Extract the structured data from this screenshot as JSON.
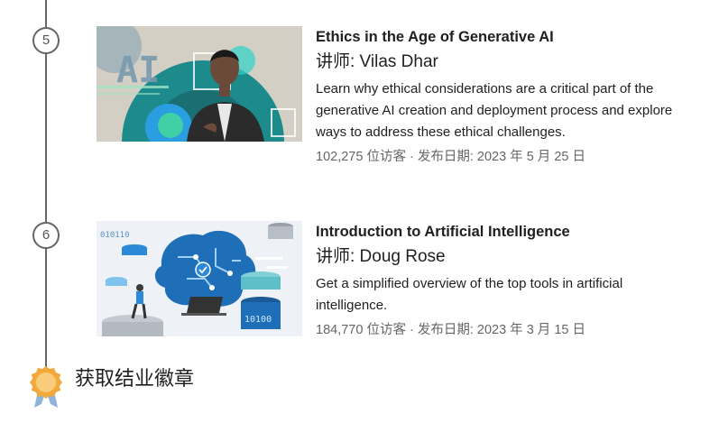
{
  "courses": [
    {
      "step": "5",
      "title": "Ethics in the Age of Generative AI",
      "instructor": "讲师: Vilas Dhar",
      "description": "Learn why ethical considerations are a critical part of the generative AI creation and deployment process and explore ways to address these ethical challenges.",
      "meta": "102,275 位访客  · 发布日期: 2023 年 5 月 25 日",
      "thumbnail_text": "AI"
    },
    {
      "step": "6",
      "title": "Introduction to Artificial Intelligence",
      "instructor": "讲师: Doug Rose",
      "description": "Get a simplified overview of the top tools in artificial intelligence.",
      "meta": "184,770 位访客  · 发布日期: 2023 年 3 月 15 日",
      "thumbnail_text_top": "010110",
      "thumbnail_text_bottom": "10100"
    }
  ],
  "badge": {
    "label": "获取结业徽章",
    "icon": "badge-medal-icon"
  },
  "colors": {
    "timeline": "#666666",
    "badge_gold": "#f2a93b",
    "thumbnail_teal": "#1b8a8a",
    "thumbnail_blue": "#1e6fb8"
  }
}
